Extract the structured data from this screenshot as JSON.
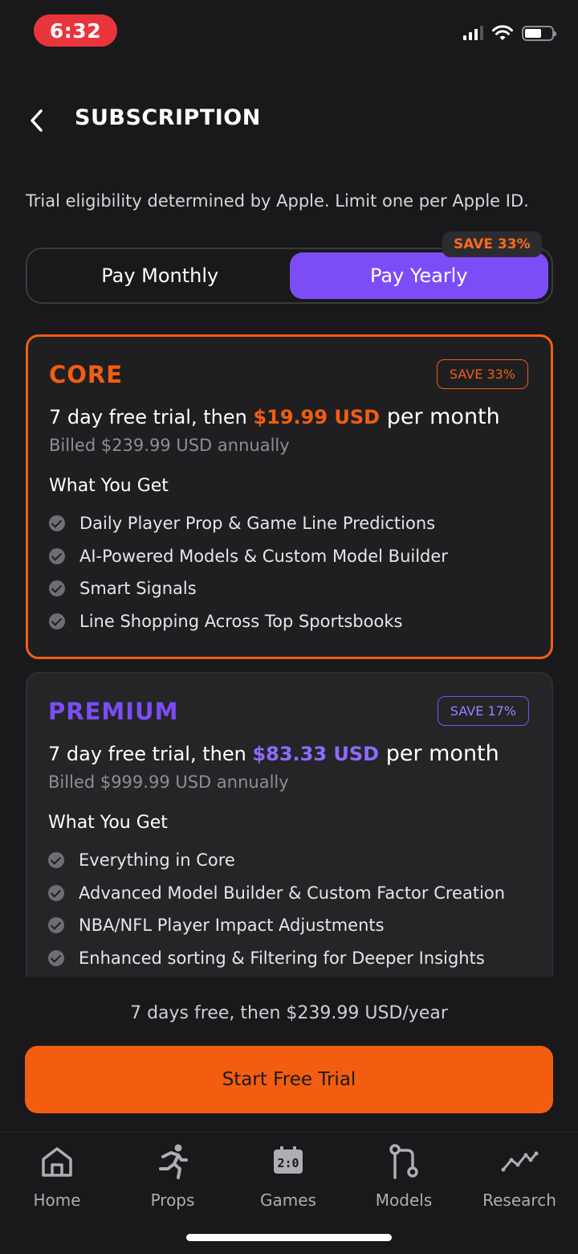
{
  "status_bar": {
    "time": "6:32"
  },
  "header": {
    "title": "SUBSCRIPTION"
  },
  "notice": "Trial eligibility determined by Apple. Limit one per Apple ID.",
  "billing_toggle": {
    "monthly_label": "Pay Monthly",
    "yearly_label": "Pay Yearly",
    "selected": "yearly",
    "save_tag": "SAVE 33%"
  },
  "plans": [
    {
      "name": "CORE",
      "badge": "SAVE 33%",
      "price_prefix": "7 day free trial, then ",
      "price": "$19.99 USD",
      "price_suffix": " per month",
      "billed": "Billed $239.99 USD annually",
      "features_title": "What You Get",
      "features": [
        "Daily Player Prop & Game Line Predictions",
        "AI-Powered Models & Custom Model Builder",
        "Smart Signals",
        "Line Shopping Across Top Sportsbooks"
      ],
      "selected": true,
      "accent": "#f25d10"
    },
    {
      "name": "PREMIUM",
      "badge": "SAVE 17%",
      "price_prefix": "7 day free trial, then ",
      "price": "$83.33 USD",
      "price_suffix": " per month",
      "billed": "Billed $999.99 USD annually",
      "features_title": "What You Get",
      "features": [
        "Everything in Core",
        "Advanced Model Builder & Custom Factor Creation",
        "NBA/NFL Player Impact Adjustments",
        "Enhanced sorting & Filtering for Deeper Insights"
      ],
      "selected": false,
      "accent": "#7c4df6"
    }
  ],
  "summary": "7 days free, then $239.99 USD/year",
  "cta": {
    "label": "Start Free Trial"
  },
  "tabbar": {
    "items": [
      {
        "label": "Home",
        "icon": "home-icon"
      },
      {
        "label": "Props",
        "icon": "running-person-icon"
      },
      {
        "label": "Games",
        "icon": "scoreboard-icon"
      },
      {
        "label": "Models",
        "icon": "git-branch-icon"
      },
      {
        "label": "Research",
        "icon": "trend-line-icon"
      }
    ]
  },
  "colors": {
    "accent_orange": "#f25d10",
    "accent_purple": "#7c4df6",
    "background": "#19191b"
  }
}
